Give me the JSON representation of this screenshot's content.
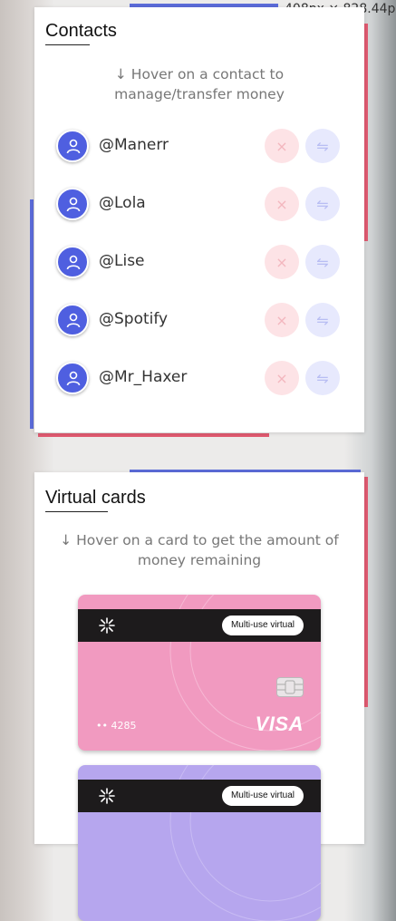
{
  "viewport_dimension": "408px × 828.44p",
  "colors": {
    "accent_blue": "#5b6bd8",
    "accent_red": "#e05a70",
    "avatar": "#4f5fe0"
  },
  "contacts_panel": {
    "title": "Contacts",
    "hint": "↓ Hover on a contact to manage/transfer money",
    "delete_icon": "×",
    "transfer_icon": "⇋",
    "contacts": [
      {
        "handle": "@Manerr"
      },
      {
        "handle": "@Lola"
      },
      {
        "handle": "@Lise"
      },
      {
        "handle": "@Spotify"
      },
      {
        "handle": "@Mr_Haxer"
      }
    ]
  },
  "cards_panel": {
    "title": "Virtual cards",
    "hint": "↓ Hover on a card to get the amount of money remaining",
    "cards": [
      {
        "badge": "Multi-use virtual",
        "number": "•• 4285",
        "brand": "VISA",
        "color": "#f19ac0"
      },
      {
        "badge": "Multi-use virtual",
        "color": "#b6a6ee"
      }
    ]
  }
}
